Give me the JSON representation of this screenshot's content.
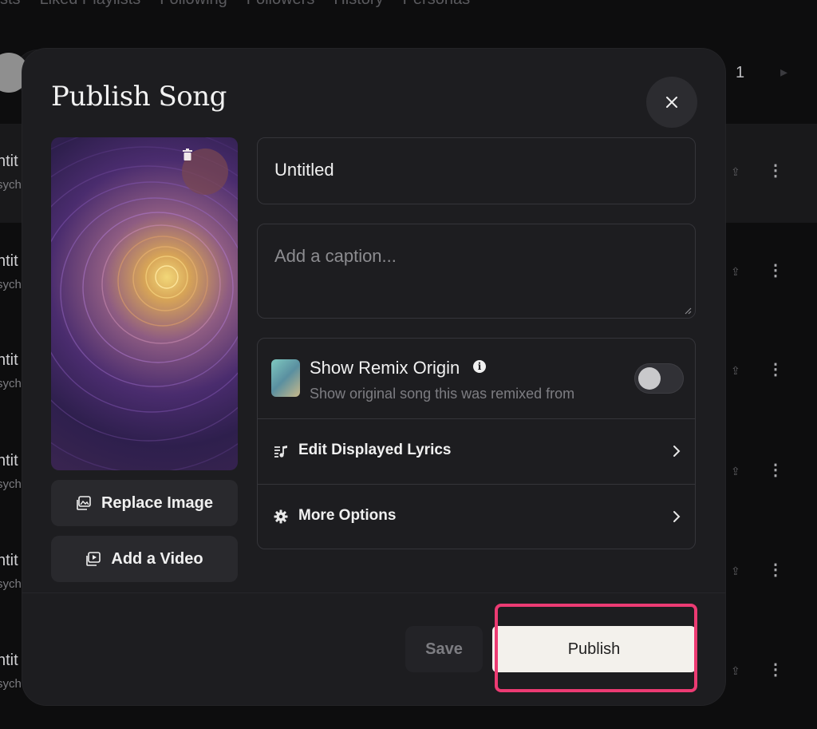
{
  "background": {
    "tabs": [
      "sts",
      "Liked Playlists",
      "Following",
      "Followers",
      "History",
      "Personas"
    ],
    "page_number": "1",
    "rows": [
      {
        "title": "ntit",
        "subtitle": "sych"
      },
      {
        "title": "ntit",
        "subtitle": "sych"
      },
      {
        "title": "ntit",
        "subtitle": "sych"
      },
      {
        "title": "ntit",
        "subtitle": "sych"
      },
      {
        "title": "ntit",
        "subtitle": "sych"
      },
      {
        "title": "ntit",
        "subtitle": "sych"
      }
    ]
  },
  "modal": {
    "title": "Publish Song",
    "close_icon": "close-icon",
    "cover": {
      "delete_icon": "trash-icon"
    },
    "replace_image_label": "Replace Image",
    "add_video_label": "Add a Video",
    "song_title_value": "Untitled",
    "caption_placeholder": "Add a caption...",
    "remix": {
      "title": "Show Remix Origin",
      "subtitle": "Show original song this was remixed from",
      "toggle_on": false
    },
    "edit_lyrics_label": "Edit Displayed Lyrics",
    "more_options_label": "More Options",
    "save_label": "Save",
    "publish_label": "Publish"
  },
  "colors": {
    "accent_highlight": "#ec3b73",
    "publish_bg": "#f3f1ec",
    "modal_bg": "#1d1d20"
  }
}
